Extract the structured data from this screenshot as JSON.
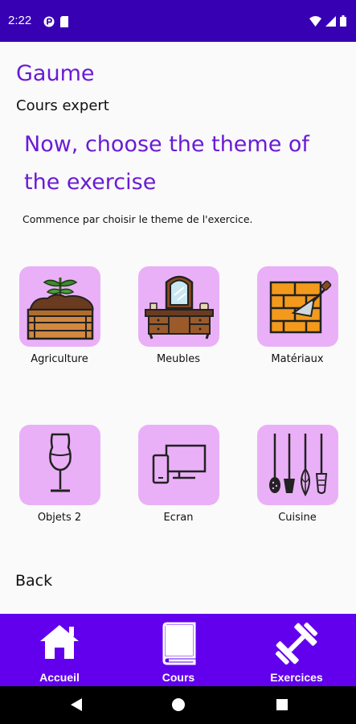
{
  "status_bar": {
    "time": "2:22",
    "icons": [
      "notification-icon",
      "sim-icon",
      "wifi-icon",
      "signal-icon",
      "battery-icon"
    ]
  },
  "header": {
    "title": "Gaume",
    "subtitle": "Cours expert",
    "heading": "Now,  choose the theme of the exercise",
    "instruction": "Commence par choisir le theme de l'exercice."
  },
  "themes": [
    {
      "label": "Agriculture",
      "icon": "planter-box-icon"
    },
    {
      "label": "Meubles",
      "icon": "dresser-icon"
    },
    {
      "label": "Matériaux",
      "icon": "bricks-trowel-icon"
    },
    {
      "label": "Objets 2",
      "icon": "wine-glass-icon"
    },
    {
      "label": "Ecran",
      "icon": "devices-icon"
    },
    {
      "label": "Cuisine",
      "icon": "kitchen-utensils-icon"
    }
  ],
  "back_label": "Back",
  "bottom_nav": [
    {
      "label": "Accueil",
      "icon": "home-icon"
    },
    {
      "label": "Cours",
      "icon": "book-icon"
    },
    {
      "label": "Exercices",
      "icon": "dumbbell-icon"
    }
  ],
  "colors": {
    "status_bar": "#3700b3",
    "accent": "#6a1bd6",
    "tile": "#eab0f7",
    "bottom_nav": "#6200ee"
  }
}
